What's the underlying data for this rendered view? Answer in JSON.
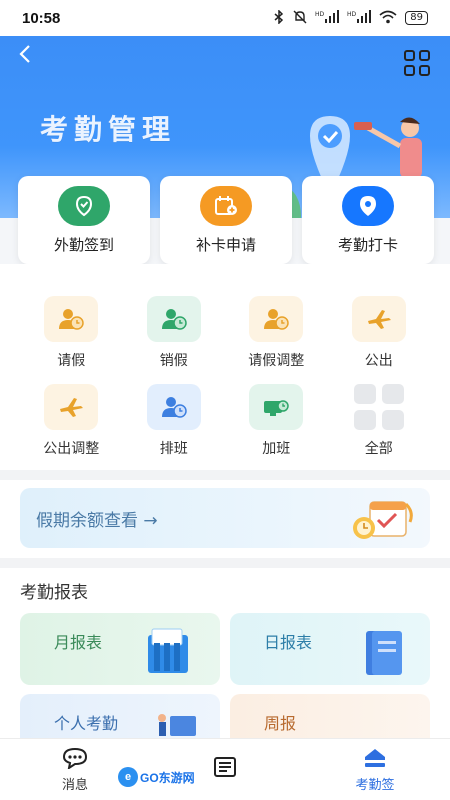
{
  "status": {
    "time": "10:58",
    "signal1": "HD",
    "signal2": "HD",
    "battery": "89"
  },
  "header": {
    "title": "考勤管理"
  },
  "quick_actions": [
    {
      "label": "外勤签到",
      "icon": "check-location-icon",
      "color": "#2fa66a"
    },
    {
      "label": "补卡申请",
      "icon": "calendar-add-icon",
      "color": "#f59a23"
    },
    {
      "label": "考勤打卡",
      "icon": "map-pin-icon",
      "color": "#1677ff"
    }
  ],
  "functions": [
    {
      "label": "请假",
      "icon": "user-clock-icon"
    },
    {
      "label": "销假",
      "icon": "user-clock-icon"
    },
    {
      "label": "请假调整",
      "icon": "user-clock-icon"
    },
    {
      "label": "公出",
      "icon": "airplane-icon"
    },
    {
      "label": "公出调整",
      "icon": "airplane-icon"
    },
    {
      "label": "排班",
      "icon": "user-clock-icon"
    },
    {
      "label": "加班",
      "icon": "monitor-clock-icon"
    },
    {
      "label": "全部",
      "icon": "grid-icon"
    }
  ],
  "banner": {
    "text": "假期余额查看 →"
  },
  "reports": {
    "title": "考勤报表",
    "items": [
      {
        "label": "月报表"
      },
      {
        "label": "日报表"
      },
      {
        "label": "个人考勤"
      },
      {
        "label": "周报"
      }
    ]
  },
  "bottom_nav": [
    {
      "label": "消息",
      "icon": "chat-icon"
    },
    {
      "label": "",
      "icon": "list-icon"
    },
    {
      "label": "考勤签",
      "icon": "home-icon"
    }
  ],
  "watermark": {
    "text": "GO东游网"
  },
  "colors": {
    "primary": "#3c8ef7",
    "active_nav": "#2e6fe0"
  }
}
